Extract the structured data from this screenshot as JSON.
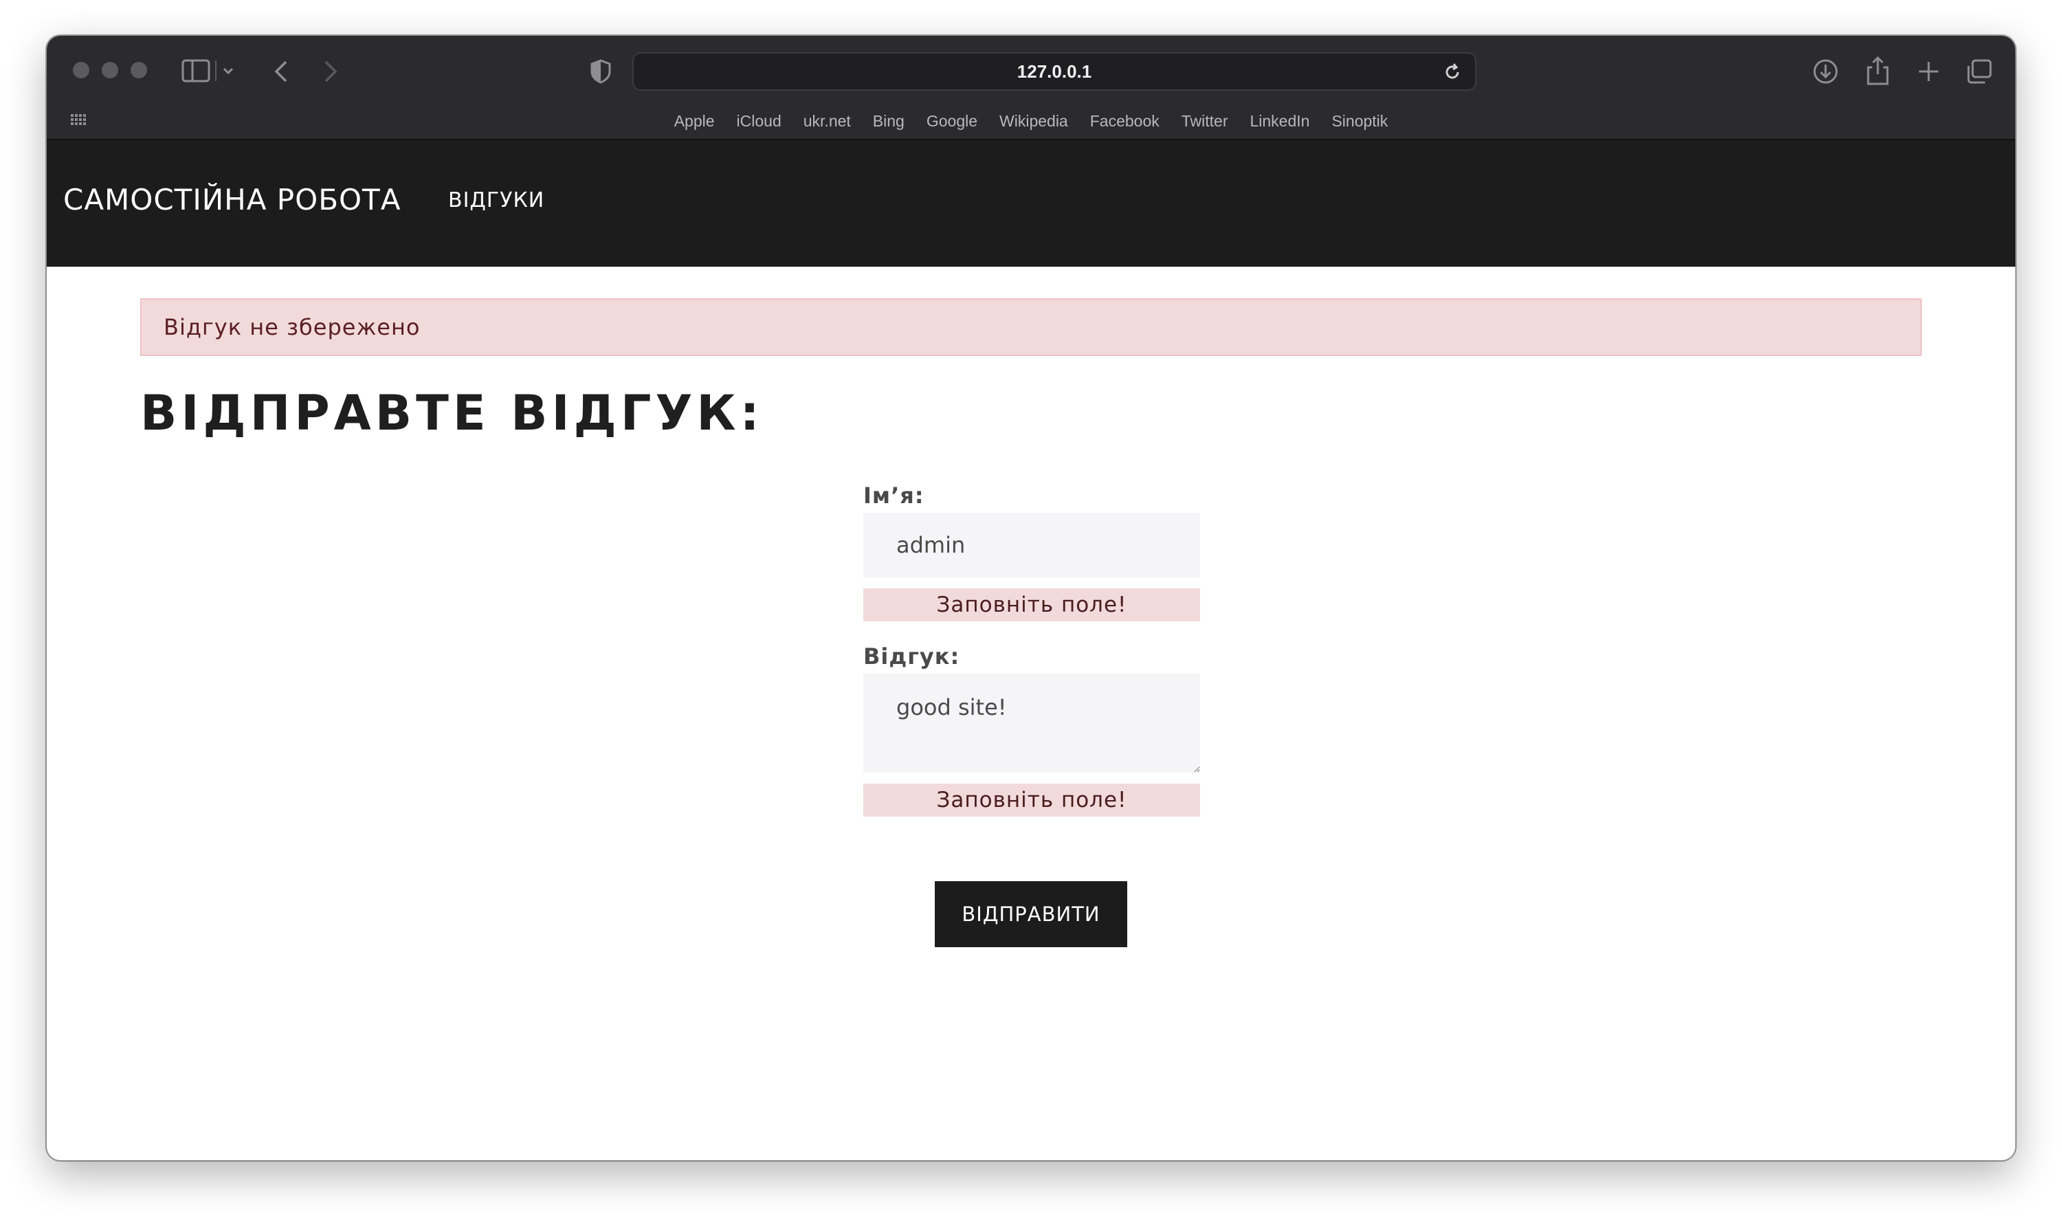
{
  "browser": {
    "url": "127.0.0.1",
    "bookmarks": [
      "Apple",
      "iCloud",
      "ukr.net",
      "Bing",
      "Google",
      "Wikipedia",
      "Facebook",
      "Twitter",
      "LinkedIn",
      "Sinoptik"
    ]
  },
  "nav": {
    "brand": "САМОСТІЙНА РОБОТА",
    "link": "ВІДГУКИ"
  },
  "alert": "Відгук не збережено",
  "heading": "ВІДПРАВТЕ ВІДГУК:",
  "form": {
    "name_label": "Ім’я:",
    "name_value": "admin",
    "name_error": "Заповніть поле!",
    "review_label": "Відгук:",
    "review_value": "good site!",
    "review_error": "Заповніть поле!",
    "submit_label": "ВІДПРАВИТИ"
  },
  "colors": {
    "nav_bg": "#1c1c1c",
    "alert_bg": "#f2dadb",
    "button_bg": "#1c1c1c"
  }
}
